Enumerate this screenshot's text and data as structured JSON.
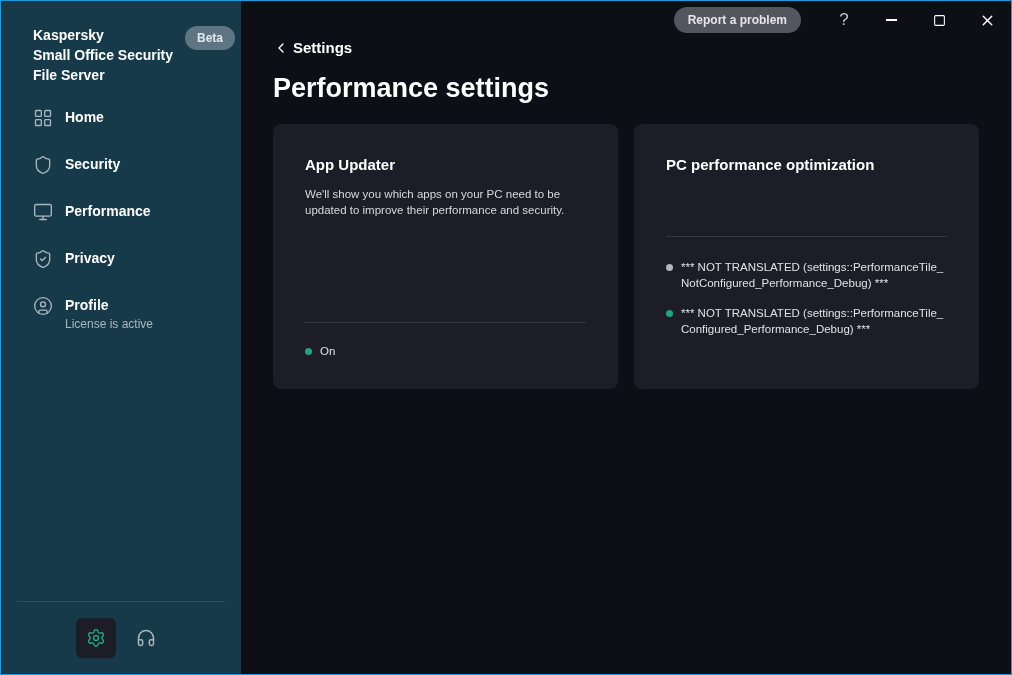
{
  "sidebar": {
    "product_lines": [
      "Kaspersky",
      "Small Office Security",
      "File Server"
    ],
    "badge": "Beta",
    "items": [
      {
        "kind": "home",
        "label": "Home"
      },
      {
        "kind": "security",
        "label": "Security"
      },
      {
        "kind": "performance",
        "label": "Performance"
      },
      {
        "kind": "privacy",
        "label": "Privacy"
      },
      {
        "kind": "profile",
        "label": "Profile",
        "subtitle": "License is active"
      }
    ],
    "bottom_buttons": [
      {
        "kind": "settings",
        "selected": true
      },
      {
        "kind": "support",
        "selected": false
      }
    ]
  },
  "title_bar": {
    "report_button": "Report a problem",
    "help": "?"
  },
  "back_link": "Settings",
  "page_title": "Performance settings",
  "cards": [
    {
      "title": "App Updater",
      "description": "We'll show you which apps on your PC need to be updated to improve their performance and security.",
      "statuses": [
        {
          "text": "On",
          "color": "#1fa386"
        }
      ]
    },
    {
      "title": "PC performance optimization",
      "statuses": [
        {
          "text": "*** NOT TRANSLATED (settings::PerformanceTile_NotConfigured_Performance_Debug) ***",
          "color": "#b4b6bd"
        },
        {
          "text": "*** NOT TRANSLATED (settings::PerformanceTile_Configured_Performance_Debug) ***",
          "color": "#1fa386"
        }
      ]
    }
  ]
}
